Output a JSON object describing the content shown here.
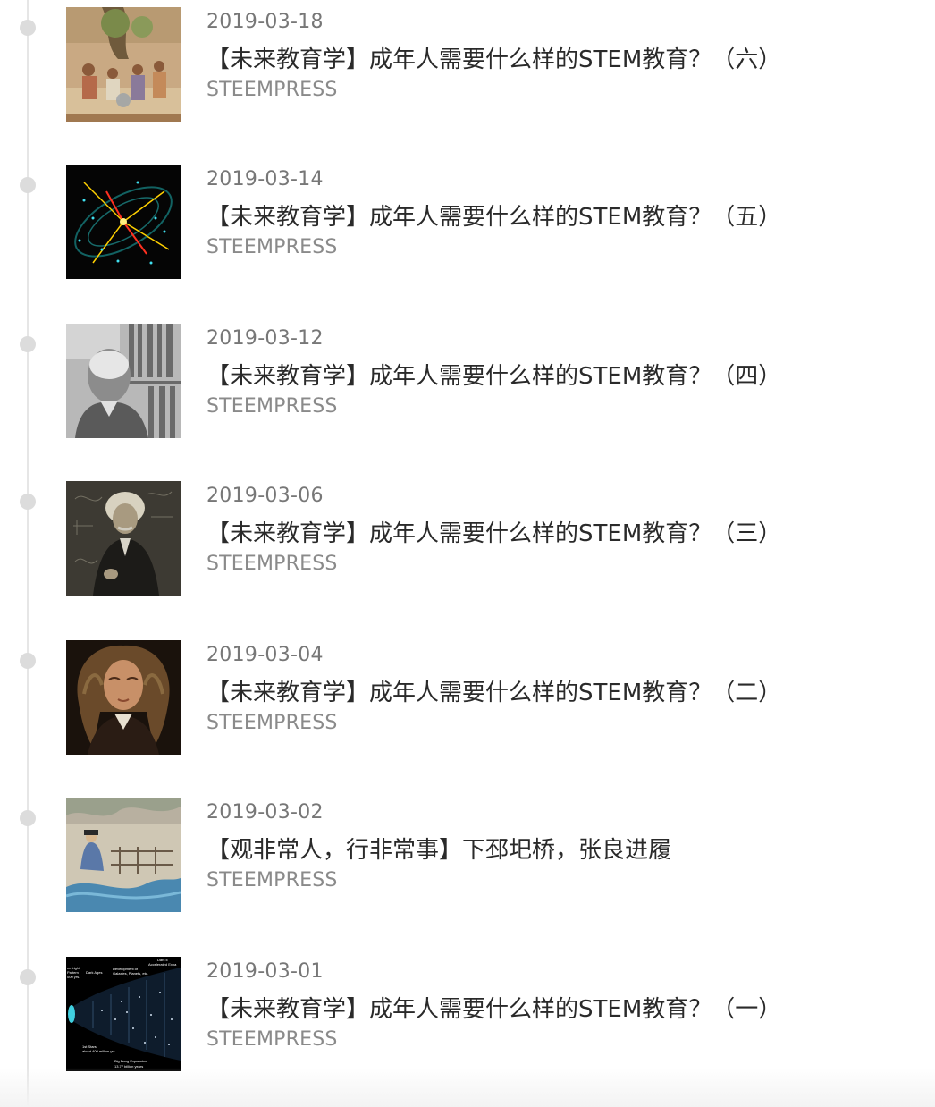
{
  "posts": [
    {
      "date": "2019-03-18",
      "title": "【未来教育学】成年人需要什么样的STEM教育？（六）",
      "source": "STEEMPRESS",
      "thumbnail": "ancient-mosaic-philosophers-image"
    },
    {
      "date": "2019-03-14",
      "title": "【未来教育学】成年人需要什么样的STEM教育？（五）",
      "source": "STEEMPRESS",
      "thumbnail": "particle-collision-image"
    },
    {
      "date": "2019-03-12",
      "title": "【未来教育学】成年人需要什么样的STEM教育？（四）",
      "source": "STEEMPRESS",
      "thumbnail": "elderly-man-bookshelf-photo"
    },
    {
      "date": "2019-03-06",
      "title": "【未来教育学】成年人需要什么样的STEM教育？（三）",
      "source": "STEEMPRESS",
      "thumbnail": "einstein-chalkboard-photo"
    },
    {
      "date": "2019-03-04",
      "title": "【未来教育学】成年人需要什么样的STEM教育？（二）",
      "source": "STEEMPRESS",
      "thumbnail": "newton-portrait-painting"
    },
    {
      "date": "2019-03-02",
      "title": "【观非常人，行非常事】下邳圯桥，张良进履",
      "source": "STEEMPRESS",
      "thumbnail": "chinese-painting-bridge-image"
    },
    {
      "date": "2019-03-01",
      "title": "【未来教育学】成年人需要什么样的STEM教育？（一）",
      "source": "STEEMPRESS",
      "thumbnail": "universe-expansion-diagram",
      "thumbnail_text": {
        "l1": "ne Light",
        "l2": "Pattern",
        "l3": "000 yrs.",
        "dark_ages": "Dark Ages",
        "dev": "Development of",
        "gal": "Galaxies, Planets, etc.",
        "dark_e": "Dark E",
        "accel": "Accelerated Expa",
        "first_stars": "1st Stars",
        "first_stars2": "about 400 million yrs.",
        "big_bang": "Big Bang Expansion",
        "years": "13.77 billion years"
      }
    }
  ],
  "colors": {
    "timeline": "#e6e6e6",
    "dot": "#dcdcdc",
    "date": "#777777",
    "title": "#2a2a2a",
    "source": "#8a8a8a"
  }
}
